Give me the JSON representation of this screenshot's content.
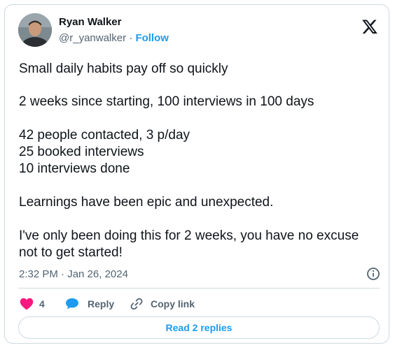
{
  "author": {
    "name": "Ryan Walker",
    "handle": "@r_yanwalker",
    "separator": "·",
    "follow_label": "Follow"
  },
  "tweet": {
    "lines": [
      "Small daily habits pay off so quickly",
      "2 weeks since starting, 100 interviews in 100 days",
      "42 people contacted, 3 p/day",
      "25 booked interviews",
      "10 interviews done",
      "Learnings have been epic and unexpected.",
      "I've only been doing this for 2 weeks, you have no excuse",
      "not to get started!"
    ],
    "timestamp": "2:32 PM · Jan 26, 2024"
  },
  "actions": {
    "like_count": "4",
    "reply_label": "Reply",
    "copy_label": "Copy link",
    "read_replies_label": "Read 2 replies"
  },
  "icons": {
    "logo": "x-logo-icon",
    "info": "info-icon",
    "like": "heart-icon",
    "reply": "speech-bubble-icon",
    "copy": "link-icon"
  },
  "colors": {
    "text": "#0f1419",
    "secondary": "#536471",
    "accent": "#1d9bf0",
    "like": "#f91880",
    "border": "#cfd9de"
  }
}
